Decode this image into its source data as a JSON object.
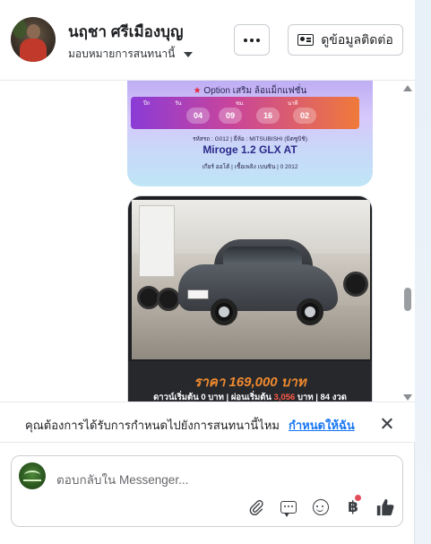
{
  "header": {
    "contact_name": "นฤชา ศรีเมืองบุญ",
    "assign_label": "มอบหมายการสนทนานี้",
    "more_label": "more-options",
    "contact_button_label": "ดูข้อมูลติดต่อ"
  },
  "chat": {
    "image1": {
      "option_prefix": "★",
      "option_text": "Option เสริม ล้อแม็กแฟชั่น",
      "timer_labels": [
        "ปีก",
        "วัน",
        "ชม.",
        "นาที"
      ],
      "timer_values": [
        "04",
        "09",
        "16",
        "02"
      ],
      "info": "รหัสรถ : G012 | ยี่ห้อ : MITSUBISHI (มิตซูบิชิ)",
      "model": "Miroge 1.2 GLX AT",
      "features": "เกียร์ ออโต้  |  เชื้อเพลิง เบนซิน  |  0 2012"
    },
    "image2": {
      "price": "ราคา 169,000 บาท",
      "terms_a": "ดาวน์เริ่มต้น 0 บาท | ผ่อนเริ่มต้น ",
      "terms_highlight": "3,056",
      "terms_b": " บาท | 84 งวด"
    }
  },
  "notice": {
    "text": "คุณต้องการได้รับการกำหนดไปยังการสนทนานี้ไหม",
    "link": "กำหนดให้ฉัน"
  },
  "composer": {
    "placeholder": "ตอบกลับใน Messenger..."
  },
  "icons": [
    "paperclip-icon",
    "saved-reply-icon",
    "emoji-icon",
    "baht-payment-icon",
    "like-thumb-icon"
  ],
  "colors": {
    "accent": "#1877f2",
    "price_orange": "#f08a2e",
    "highlight_red": "#ff5a4a",
    "badge_red": "#e44d5a"
  }
}
